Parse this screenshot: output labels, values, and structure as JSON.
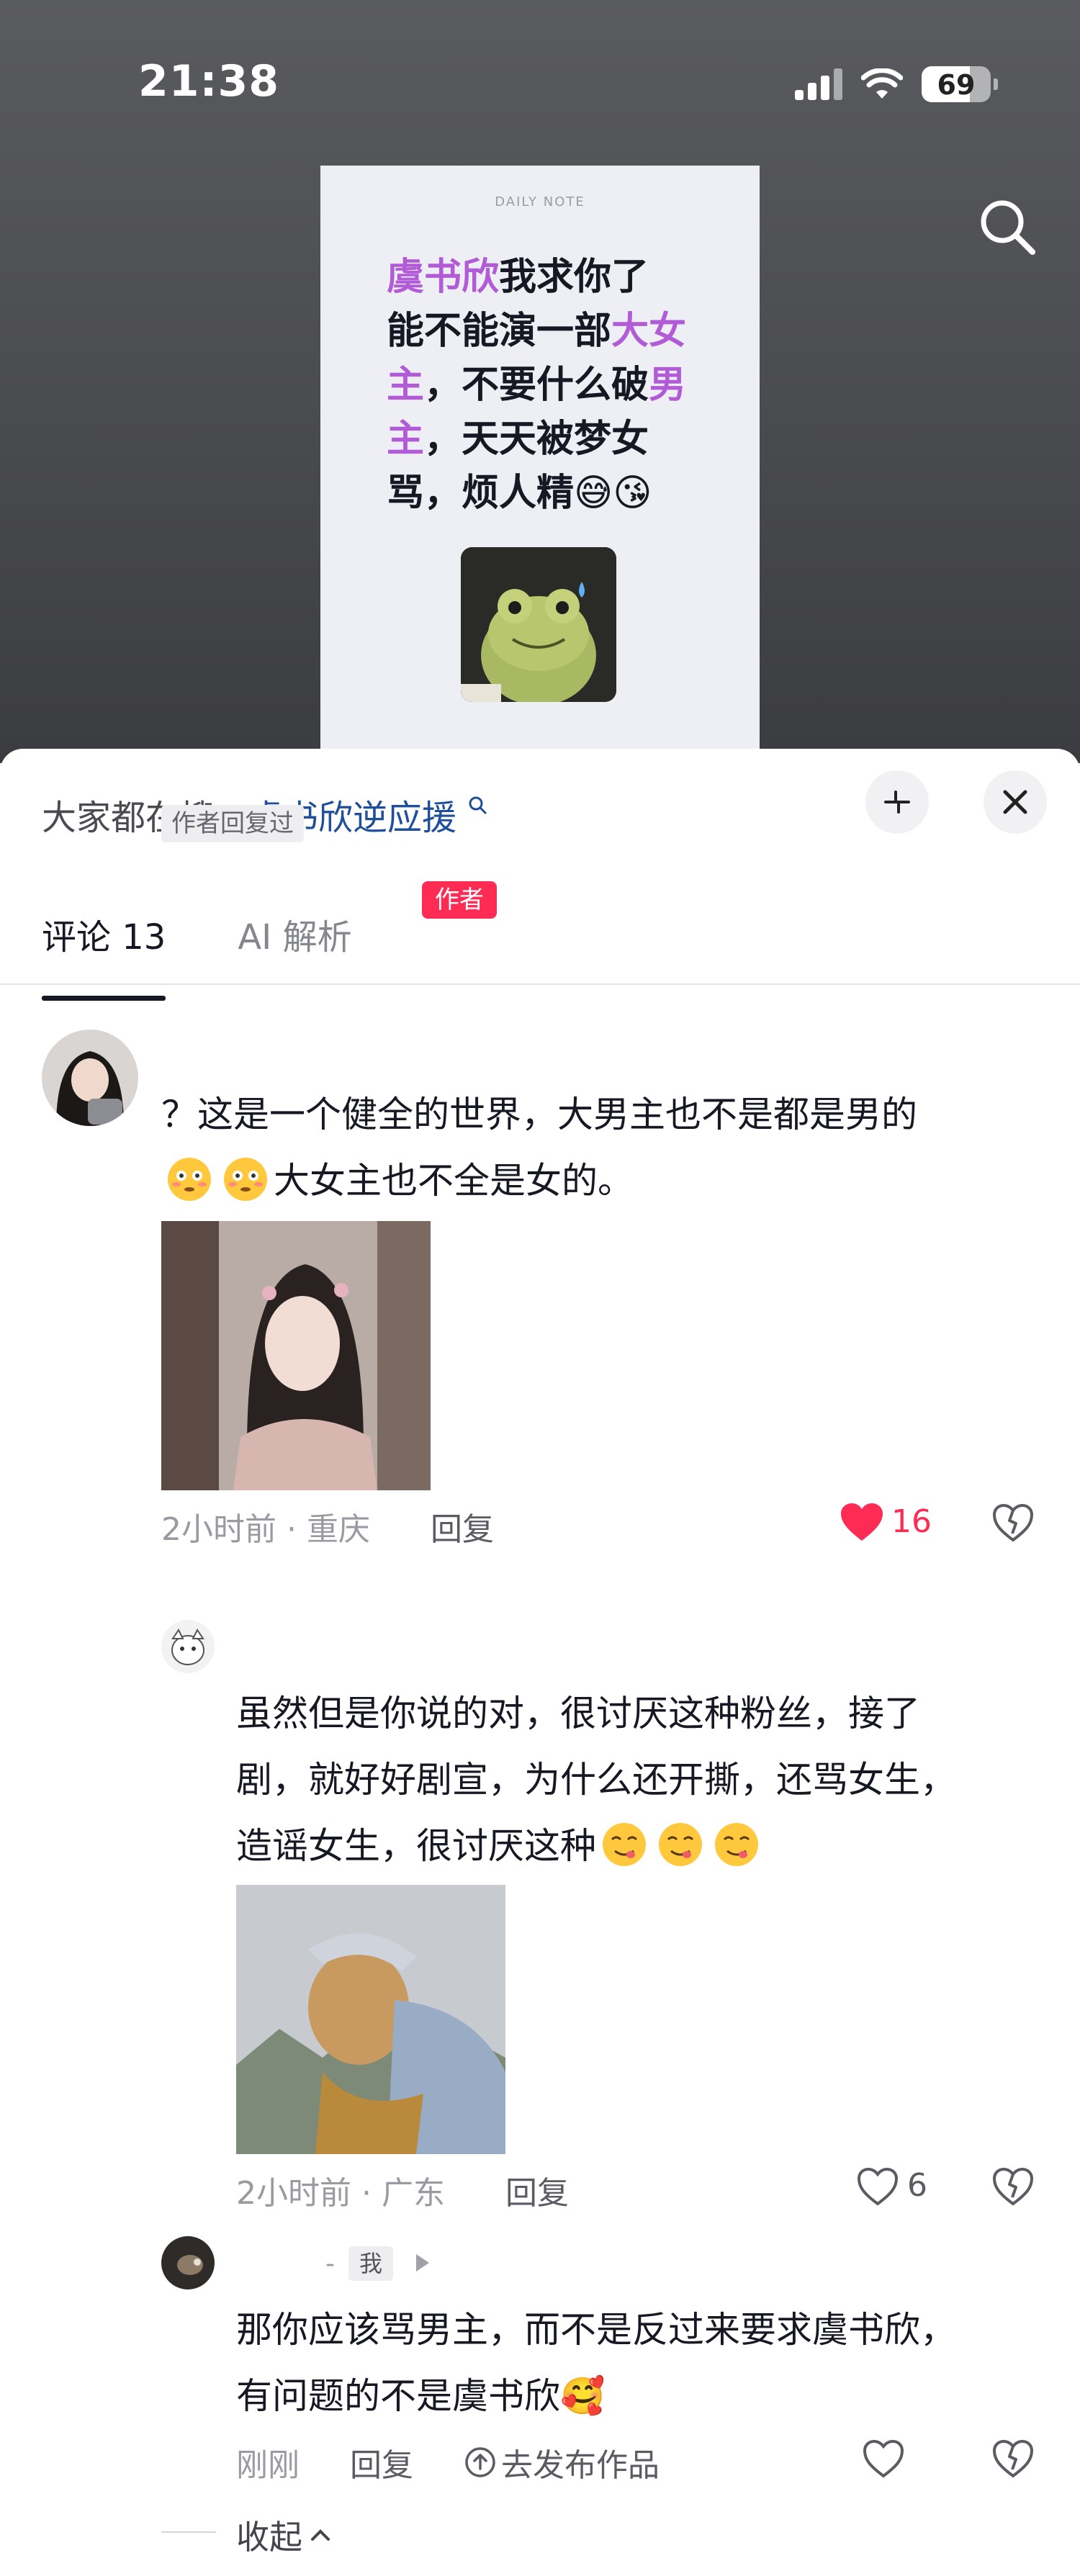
{
  "status_bar": {
    "time": "21:38",
    "battery": "69"
  },
  "video": {
    "note_brand": "DAILY NOTE",
    "note_lines": [
      [
        {
          "t": "虞书欣",
          "hl": true
        },
        {
          "t": "我求你了",
          "hl": false
        }
      ],
      [
        {
          "t": "能不能演一部",
          "hl": false
        },
        {
          "t": "大女",
          "hl": true
        }
      ],
      [
        {
          "t": "主",
          "hl": true
        },
        {
          "t": "，不要什么破",
          "hl": false
        },
        {
          "t": "男",
          "hl": true
        }
      ],
      [
        {
          "t": "主",
          "hl": true
        },
        {
          "t": "，天天被梦女",
          "hl": false
        }
      ],
      [
        {
          "t": "骂，烦人精😅😘",
          "hl": false
        }
      ]
    ]
  },
  "sheet": {
    "trend_prefix": "大家都在搜：",
    "trend_term": "虞书欣逆应援",
    "tabs": {
      "comments": "评论 13",
      "ai": "AI 解析"
    }
  },
  "comments": [
    {
      "line1": "？这是一个健全的世界，大男主也不是都是男的",
      "line2_after_emoji": "大女主也不全是女的。",
      "meta": "2小时前 · 重庆",
      "reply": "回复",
      "likes": "16",
      "author_replied_badge": "作者回复过"
    },
    {
      "author_badge": "作者",
      "lines": [
        "虽然但是你说的对，很讨厌这种粉丝，接了",
        "剧，就好好剧宣，为什么还开撕，还骂女生，",
        "造谣女生，很讨厌这种"
      ],
      "meta": "2小时前 · 广东",
      "reply": "回复",
      "likes": "6"
    },
    {
      "me_dash": "-",
      "me_badge": "我",
      "lines": [
        "那你应该骂男主，而不是反过来要求虞书欣，",
        "有问题的不是虞书欣🥰"
      ],
      "meta": "刚刚",
      "reply": "回复",
      "publish": "去发布作品"
    }
  ],
  "collapse_label": "收起",
  "colors": {
    "accent_red": "#fe2c55",
    "highlight_purple": "#b15bd6",
    "trend_blue": "#1f4f9a"
  }
}
